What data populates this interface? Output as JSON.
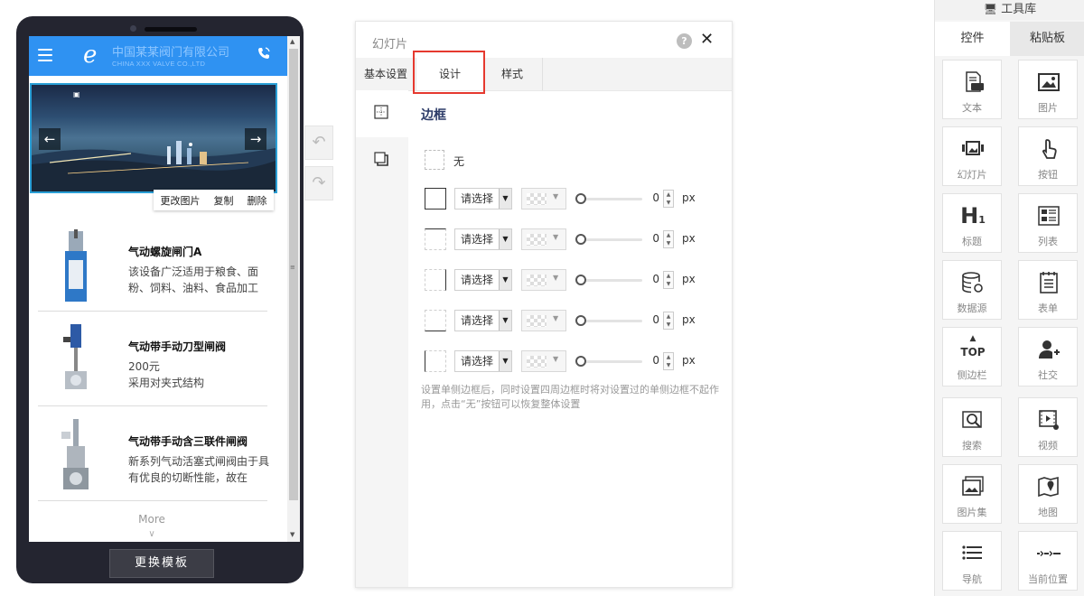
{
  "phone": {
    "company_cn": "中国某某阀门有限公司",
    "company_en": "CHINA XXX VALVE CO.,LTD",
    "slide_tools": [
      "更改图片",
      "复制",
      "删除"
    ],
    "products": [
      {
        "name": "气动螺旋闸门A",
        "desc": "该设备广泛适用于粮食、面粉、饲料、油料、食品加工"
      },
      {
        "name": "气动带手动刀型闸阀",
        "desc": "200元\n采用对夹式结构"
      },
      {
        "name": "气动带手动含三联件闸阀",
        "desc": "新系列气动活塞式闸阀由于具有优良的切断性能，故在"
      }
    ],
    "more_label": "More",
    "change_template": "更换模板"
  },
  "dialog": {
    "title": "幻灯片",
    "tabs": [
      "基本设置",
      "设计",
      "样式"
    ],
    "section_title": "边框",
    "none_label": "无",
    "select_placeholder": "请选择",
    "border_rows": [
      {
        "value": "0"
      },
      {
        "value": "0"
      },
      {
        "value": "0"
      },
      {
        "value": "0"
      },
      {
        "value": "0"
      }
    ],
    "unit": "px",
    "hint": "设置单侧边框后，同时设置四周边框时将对设置过的单侧边框不起作用，点击“无”按钮可以恢复整体设置"
  },
  "toolbox": {
    "title": "工具库",
    "tabs": [
      "控件",
      "粘贴板"
    ],
    "tools": [
      {
        "label": "文本",
        "icon": "text-icon"
      },
      {
        "label": "图片",
        "icon": "image-icon"
      },
      {
        "label": "幻灯片",
        "icon": "slideshow-icon"
      },
      {
        "label": "按钮",
        "icon": "button-icon"
      },
      {
        "label": "标题",
        "icon": "heading-icon"
      },
      {
        "label": "列表",
        "icon": "list-icon"
      },
      {
        "label": "数据源",
        "icon": "datasource-icon"
      },
      {
        "label": "表单",
        "icon": "form-icon"
      },
      {
        "label": "侧边栏",
        "icon": "sidebar-icon"
      },
      {
        "label": "社交",
        "icon": "social-icon"
      },
      {
        "label": "搜索",
        "icon": "search-icon"
      },
      {
        "label": "视频",
        "icon": "video-icon"
      },
      {
        "label": "图片集",
        "icon": "gallery-icon"
      },
      {
        "label": "地图",
        "icon": "map-icon"
      },
      {
        "label": "导航",
        "icon": "nav-icon"
      },
      {
        "label": "当前位置",
        "icon": "breadcrumb-icon"
      }
    ],
    "top_glyph": "TOP",
    "heading_glyph": "H"
  }
}
